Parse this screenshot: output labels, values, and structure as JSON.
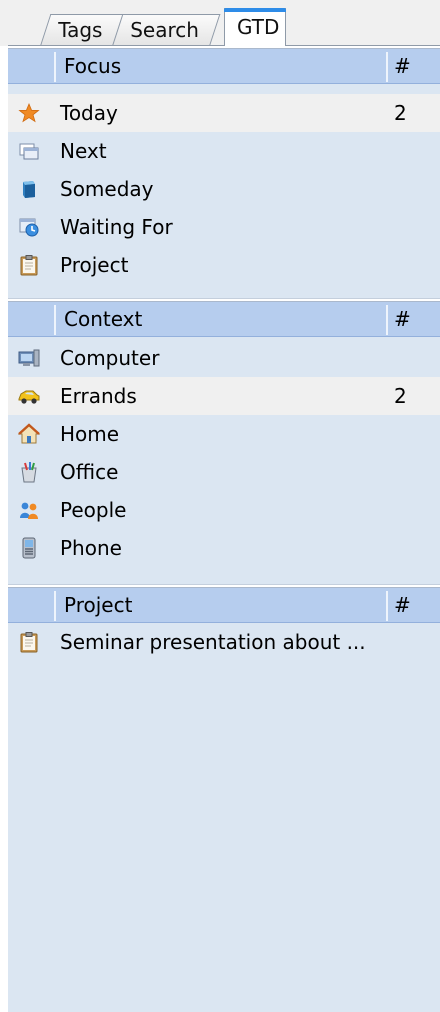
{
  "tabs": [
    "Tags",
    "Search",
    "GTD"
  ],
  "active_tab": "GTD",
  "focus": {
    "title": "Focus",
    "count_header": "#",
    "items": [
      {
        "label": "Today",
        "count": "2",
        "icon": "star-icon"
      },
      {
        "label": "Next",
        "count": "",
        "icon": "next-windows-icon"
      },
      {
        "label": "Someday",
        "count": "",
        "icon": "archive-icon"
      },
      {
        "label": "Waiting For",
        "count": "",
        "icon": "waiting-icon"
      },
      {
        "label": "Project",
        "count": "",
        "icon": "clipboard-icon"
      }
    ]
  },
  "context": {
    "title": "Context",
    "count_header": "#",
    "items": [
      {
        "label": "Computer",
        "count": "",
        "icon": "computer-icon"
      },
      {
        "label": "Errands",
        "count": "2",
        "icon": "car-icon"
      },
      {
        "label": "Home",
        "count": "",
        "icon": "home-icon"
      },
      {
        "label": "Office",
        "count": "",
        "icon": "office-icon"
      },
      {
        "label": "People",
        "count": "",
        "icon": "people-icon"
      },
      {
        "label": "Phone",
        "count": "",
        "icon": "phone-icon"
      }
    ]
  },
  "project": {
    "title": "Project",
    "count_header": "#",
    "items": [
      {
        "label": "Seminar presentation about ...",
        "count": "",
        "icon": "clipboard-icon"
      }
    ]
  }
}
